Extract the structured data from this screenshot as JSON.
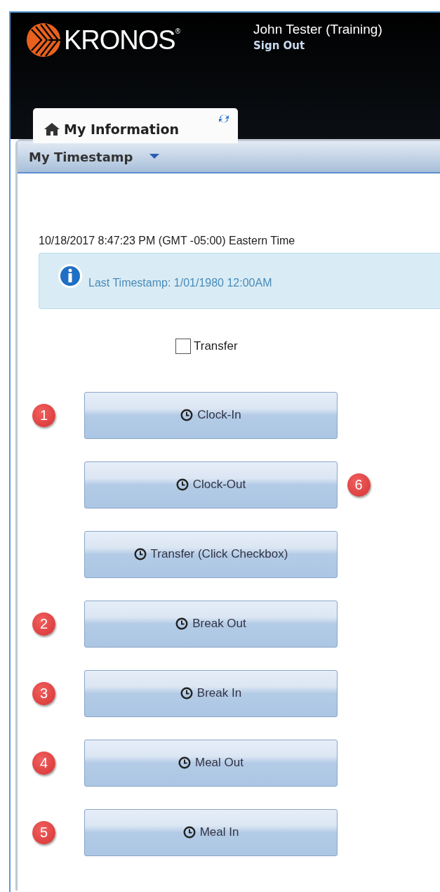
{
  "header": {
    "logo_text": "KRONOS$^{®}$",
    "user_name": "John Tester (Training)",
    "sign_out": "Sign Out"
  },
  "tabs": [
    {
      "label": "My Information",
      "selected": true
    }
  ],
  "widget": {
    "title": "My Timestamp"
  },
  "clock_text": "10/18/2017 8:47:23 PM (GMT -05:00) Eastern Time",
  "info": "Last Timestamp: 1/01/1980 12:00AM",
  "transfer_checkbox": {
    "label": "Transfer",
    "checked": false
  },
  "buttons": [
    {
      "label": "Clock-In",
      "step": {
        "number": "1",
        "on_right": false
      }
    },
    {
      "label": "Clock-Out",
      "step": {
        "number": "6",
        "on_right": true
      }
    },
    {
      "label": "Transfer (Click Checkbox)"
    },
    {
      "label": "Break Out",
      "step": {
        "number": "2",
        "on_right": false
      }
    },
    {
      "label": "Break In",
      "step": {
        "number": "3",
        "on_right": false
      }
    },
    {
      "label": "Meal Out",
      "step": {
        "number": "4",
        "on_right": false
      }
    },
    {
      "label": "Meal In",
      "step": {
        "number": "5",
        "on_right": false
      }
    }
  ]
}
